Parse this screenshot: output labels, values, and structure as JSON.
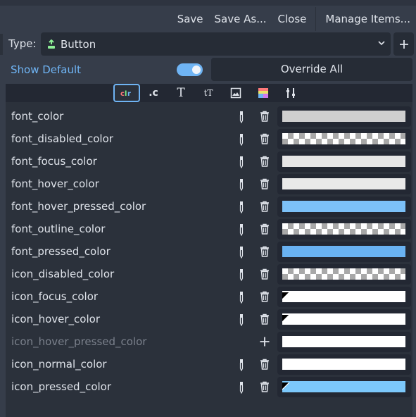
{
  "menu": {
    "save": "Save",
    "save_as": "Save As...",
    "close": "Close",
    "manage": "Manage Items..."
  },
  "type_row": {
    "label": "Type:",
    "selected": "Button"
  },
  "show_default": "Show Default",
  "show_default_on": true,
  "override_all": "Override All",
  "tabs": [
    {
      "name": "color-tab",
      "label": "clr",
      "active": true
    },
    {
      "name": "constant-tab",
      "label": ".c"
    },
    {
      "name": "font-tab",
      "label": "T"
    },
    {
      "name": "font-size-tab",
      "label": "tT"
    },
    {
      "name": "icon-tab"
    },
    {
      "name": "stylebox-tab"
    },
    {
      "name": "type-variation-tab"
    }
  ],
  "colors": {
    "accent": "#6fb4f4",
    "light_gray": "#d4d4d4",
    "near_white": "#e6e6e6",
    "light_blue": "#7cc1f8",
    "blue": "#69b2f2",
    "white": "#ffffff"
  },
  "items": [
    {
      "name": "font_color",
      "swatch": "solid",
      "color": "#cfcfcf",
      "overridden": true
    },
    {
      "name": "font_disabled_color",
      "swatch": "checker",
      "overridden": true
    },
    {
      "name": "font_focus_color",
      "swatch": "solid",
      "color": "#e6e6e6",
      "overridden": true
    },
    {
      "name": "font_hover_color",
      "swatch": "solid",
      "color": "#e9e9e9",
      "overridden": true
    },
    {
      "name": "font_hover_pressed_color",
      "swatch": "solid",
      "color": "#7cc1f8",
      "overridden": true
    },
    {
      "name": "font_outline_color",
      "swatch": "checker",
      "overridden": true
    },
    {
      "name": "font_pressed_color",
      "swatch": "solid",
      "color": "#69b2f2",
      "overridden": true
    },
    {
      "name": "icon_disabled_color",
      "swatch": "checker",
      "overridden": true
    },
    {
      "name": "icon_focus_color",
      "swatch": "solid_corner",
      "color": "#ffffff",
      "overridden": true
    },
    {
      "name": "icon_hover_color",
      "swatch": "solid_corner",
      "color": "#ffffff",
      "overridden": true
    },
    {
      "name": "icon_hover_pressed_color",
      "swatch": "solid",
      "color": "#ffffff",
      "overridden": false
    },
    {
      "name": "icon_normal_color",
      "swatch": "solid",
      "color": "#ffffff",
      "overridden": true
    },
    {
      "name": "icon_pressed_color",
      "swatch": "solid_corner",
      "color": "#7cc8fb",
      "overridden": true
    }
  ]
}
